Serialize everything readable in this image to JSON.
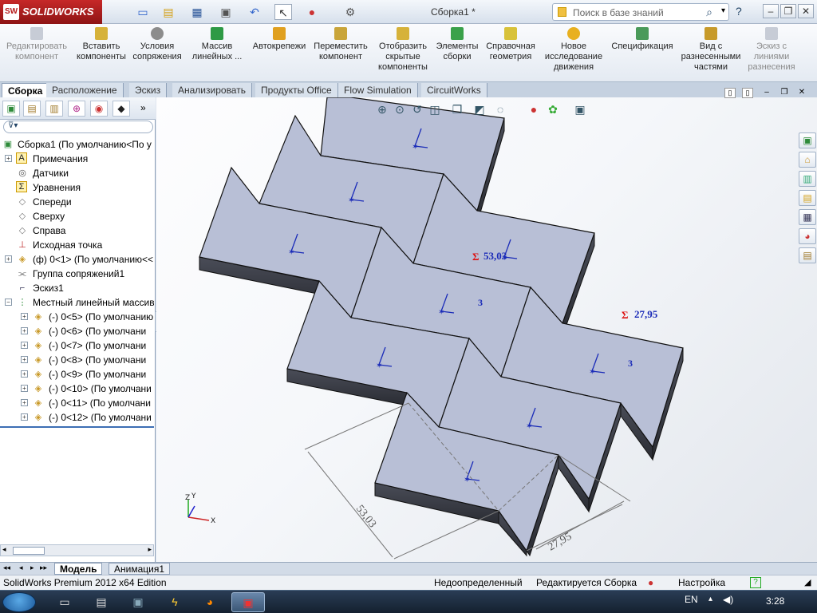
{
  "app": {
    "logo_text": "SOLIDWORKS",
    "logo_abbr": "SW",
    "document_title": "Сборка1 *",
    "search_placeholder": "Поиск в базе знаний",
    "help_label": "?",
    "accent_color": "#b71c1c"
  },
  "quick_access": [
    "new-document-icon",
    "open-folder-icon",
    "save-icon",
    "print-icon",
    "undo-icon",
    "select-arrow-icon",
    "traffic-light-icon",
    "options-icon"
  ],
  "command_manager": [
    {
      "label": "Редактировать компонент",
      "disabled": true
    },
    {
      "label": "Вставить компоненты",
      "disabled": false
    },
    {
      "label": "Условия сопряжения",
      "disabled": false
    },
    {
      "label": "Массив линейных ...",
      "disabled": false
    },
    {
      "label": "Автокрепежи",
      "disabled": false
    },
    {
      "label": "Переместить компонент",
      "disabled": false
    },
    {
      "label": "Отобразить скрытые компоненты",
      "disabled": false
    },
    {
      "label": "Элементы сборки",
      "disabled": false
    },
    {
      "label": "Справочная геометрия",
      "disabled": false
    },
    {
      "label": "Новое исследование движения",
      "disabled": false
    },
    {
      "label": "Спецификация",
      "disabled": false
    },
    {
      "label": "Вид с разнесенными частями",
      "disabled": false
    },
    {
      "label": "Эскиз с линиями разнесения",
      "disabled": true
    }
  ],
  "tabs": [
    "Сборка",
    "Расположение",
    "Эскиз",
    "Анализировать",
    "Продукты Office",
    "Flow Simulation",
    "CircuitWorks"
  ],
  "active_tab": "Сборка",
  "feature_tree": [
    {
      "label": "Сборка1  (По умолчанию<По у",
      "icon": "assembly-icon",
      "level": 0,
      "expander": ""
    },
    {
      "label": "Примечания",
      "icon": "annotations-icon",
      "level": 1,
      "expander": "+"
    },
    {
      "label": "Датчики",
      "icon": "sensors-icon",
      "level": 1,
      "expander": ""
    },
    {
      "label": "Уравнения",
      "icon": "equations-icon",
      "level": 1,
      "expander": ""
    },
    {
      "label": "Спереди",
      "icon": "plane-icon",
      "level": 1,
      "expander": ""
    },
    {
      "label": "Сверху",
      "icon": "plane-icon",
      "level": 1,
      "expander": ""
    },
    {
      "label": "Справа",
      "icon": "plane-icon",
      "level": 1,
      "expander": ""
    },
    {
      "label": "Исходная точка",
      "icon": "origin-icon",
      "level": 1,
      "expander": ""
    },
    {
      "label": "(ф) 0<1> (По умолчанию<<",
      "icon": "part-icon",
      "level": 1,
      "expander": "+"
    },
    {
      "label": "Группа сопряжений1",
      "icon": "mates-icon",
      "level": 1,
      "expander": ""
    },
    {
      "label": "Эскиз1",
      "icon": "sketch-icon",
      "level": 1,
      "expander": ""
    },
    {
      "label": "Местный линейный массив",
      "icon": "pattern-icon",
      "level": 1,
      "expander": "-"
    },
    {
      "label": "(-) 0<5> (По умолчанию",
      "icon": "part-icon",
      "level": 2,
      "expander": "+"
    },
    {
      "label": "(-) 0<6> (По умолчани",
      "icon": "part-icon",
      "level": 2,
      "expander": "+"
    },
    {
      "label": "(-) 0<7> (По умолчани",
      "icon": "part-icon",
      "level": 2,
      "expander": "+"
    },
    {
      "label": "(-) 0<8> (По умолчани",
      "icon": "part-icon",
      "level": 2,
      "expander": "+"
    },
    {
      "label": "(-) 0<9> (По умолчани",
      "icon": "part-icon",
      "level": 2,
      "expander": "+"
    },
    {
      "label": "(-) 0<10> (По умолчани",
      "icon": "part-icon",
      "level": 2,
      "expander": "+"
    },
    {
      "label": "(-) 0<11> (По умолчани",
      "icon": "part-icon",
      "level": 2,
      "expander": "+"
    },
    {
      "label": "(-) 0<12> (По умолчани",
      "icon": "part-icon",
      "level": 2,
      "expander": "+"
    }
  ],
  "viewport": {
    "dim1": "53,03",
    "dim2": "27,95",
    "sigma_label1": "Σ",
    "sigma_value1": "53,03",
    "sigma_label2": "Σ",
    "sigma_value2": "27,95",
    "patch_count_a": "3",
    "patch_count_b": "3",
    "triad_z": "Z",
    "triad_y": "Y",
    "triad_x": "X",
    "part_color": "#b8bfd6",
    "dimension_color": "#c62828"
  },
  "bottom_tabs": [
    "Модель",
    "Анимация1"
  ],
  "status": {
    "edition": "SolidWorks Premium 2012 x64 Edition",
    "definition": "Недоопределенный",
    "editing": "Редактируется Сборка",
    "customize": "Настройка"
  },
  "taskbar": {
    "lang": "EN",
    "clock": "3:28"
  }
}
